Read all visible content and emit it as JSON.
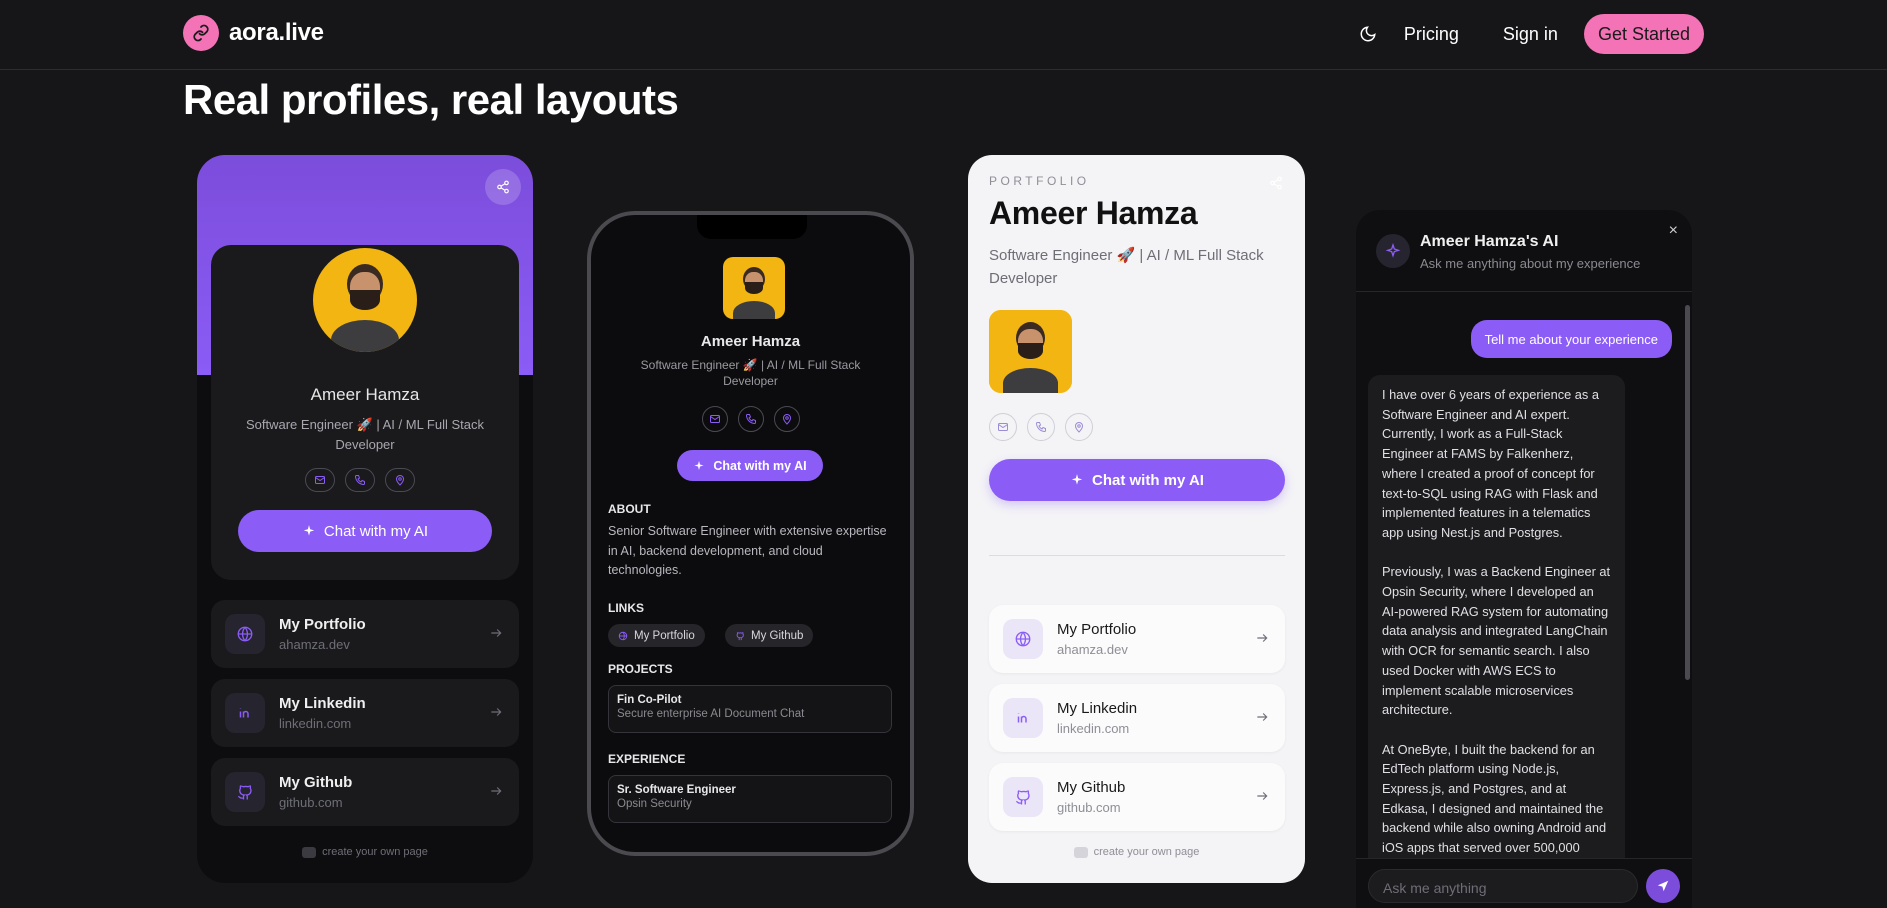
{
  "header": {
    "brand": "aora.live",
    "nav": {
      "pricing": "Pricing",
      "signin": "Sign in",
      "cta": "Get Started"
    }
  },
  "hero": {
    "title": "Real profiles, real layouts"
  },
  "profile": {
    "name": "Ameer Hamza",
    "bio": "Software Engineer 🚀 | AI / ML Full Stack Developer",
    "chat_label": "Chat with my AI",
    "links": [
      {
        "title": "My Portfolio",
        "sub": "ahamza.dev",
        "icon": "globe-icon"
      },
      {
        "title": "My Linkedin",
        "sub": "linkedin.com",
        "icon": "linkedin-icon"
      },
      {
        "title": "My Github",
        "sub": "github.com",
        "icon": "github-icon"
      }
    ],
    "footer_note": "create your own page"
  },
  "phone": {
    "about_heading": "ABOUT",
    "about_text": "Senior Software Engineer with extensive expertise in AI, backend development, and cloud technologies.",
    "links_heading": "LINKS",
    "chips": [
      "My Portfolio",
      "My Github"
    ],
    "projects_heading": "PROJECTS",
    "project": {
      "title": "Fin Co-Pilot",
      "sub": "Secure enterprise AI Document Chat"
    },
    "experience_heading": "EXPERIENCE",
    "experience": {
      "title": "Sr. Software Engineer",
      "sub": "Opsin Security"
    }
  },
  "portfolio_card": {
    "label": "PORTFOLIO"
  },
  "chat": {
    "title": "Ameer Hamza's AI",
    "subtitle": "Ask me anything about my experience",
    "close": "×",
    "user_message": "Tell me about your experience",
    "ai_paragraphs": [
      "I have over 6 years of experience as a Software Engineer and AI expert. Currently, I work as a Full-Stack Engineer at FAMS by Falkenherz, where I created a proof of concept for text-to-SQL using RAG with Flask and implemented features in a telematics app using Nest.js and Postgres.",
      "Previously, I was a Backend Engineer at Opsin Security, where I developed an AI-powered RAG system for automating data analysis and integrated LangChain with OCR for semantic search. I also used Docker with AWS ECS to implement scalable microservices architecture.",
      "At OneByte, I built the backend for an EdTech platform using Node.js, Express.js, and Postgres, and at Edkasa, I designed and maintained the backend while also owning Android and iOS apps that served over 500,000"
    ],
    "input_placeholder": "Ask me anything"
  },
  "colors": {
    "accent": "#8b5cf6",
    "brand": "#f472b6",
    "background": "#161618"
  }
}
